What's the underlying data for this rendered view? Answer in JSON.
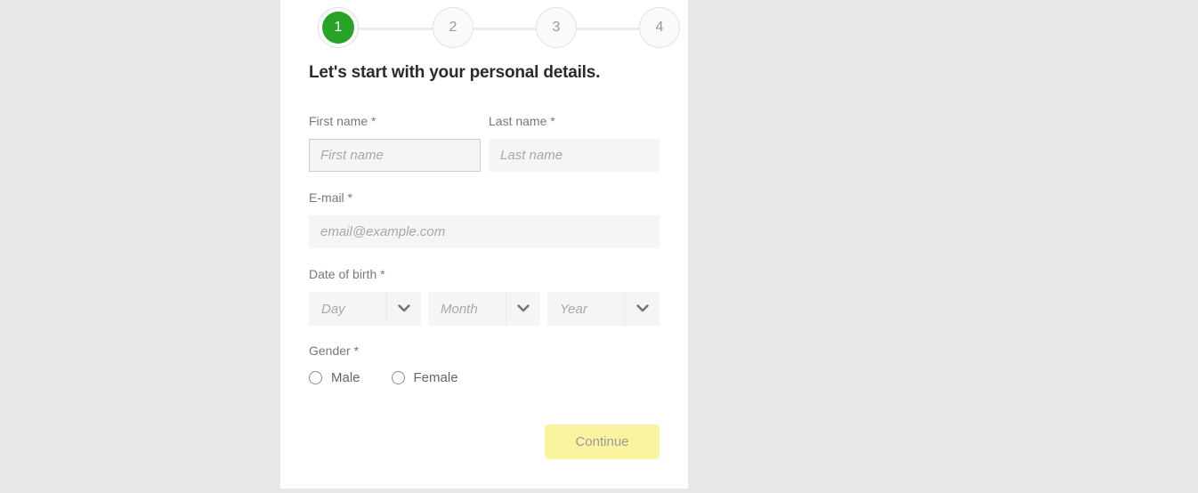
{
  "theme": {
    "page_background": "#e8e8e8",
    "card_background": "#ffffff",
    "active_step_color": "#27a327",
    "inactive_step_color": "#9a9a9a",
    "label_color": "#787878",
    "button_background": "#faf3a0",
    "button_text_color": "#9a9a9a"
  },
  "stepper": {
    "steps": [
      {
        "number": "1",
        "state": "active"
      },
      {
        "number": "2",
        "state": "inactive"
      },
      {
        "number": "3",
        "state": "inactive"
      },
      {
        "number": "4",
        "state": "inactive"
      }
    ]
  },
  "form": {
    "heading": "Let's start with your personal details.",
    "first_name": {
      "label": "First name *",
      "placeholder": "First name",
      "value": ""
    },
    "last_name": {
      "label": "Last name *",
      "placeholder": "Last name",
      "value": ""
    },
    "email": {
      "label": "E-mail *",
      "placeholder": "email@example.com",
      "value": ""
    },
    "date_of_birth": {
      "label": "Date of birth *",
      "day": {
        "placeholder": "Day",
        "value": ""
      },
      "month": {
        "placeholder": "Month",
        "value": ""
      },
      "year": {
        "placeholder": "Year",
        "value": ""
      }
    },
    "gender": {
      "label": "Gender *",
      "options": [
        {
          "label": "Male",
          "selected": false
        },
        {
          "label": "Female",
          "selected": false
        }
      ]
    },
    "submit": {
      "label": "Continue"
    }
  }
}
